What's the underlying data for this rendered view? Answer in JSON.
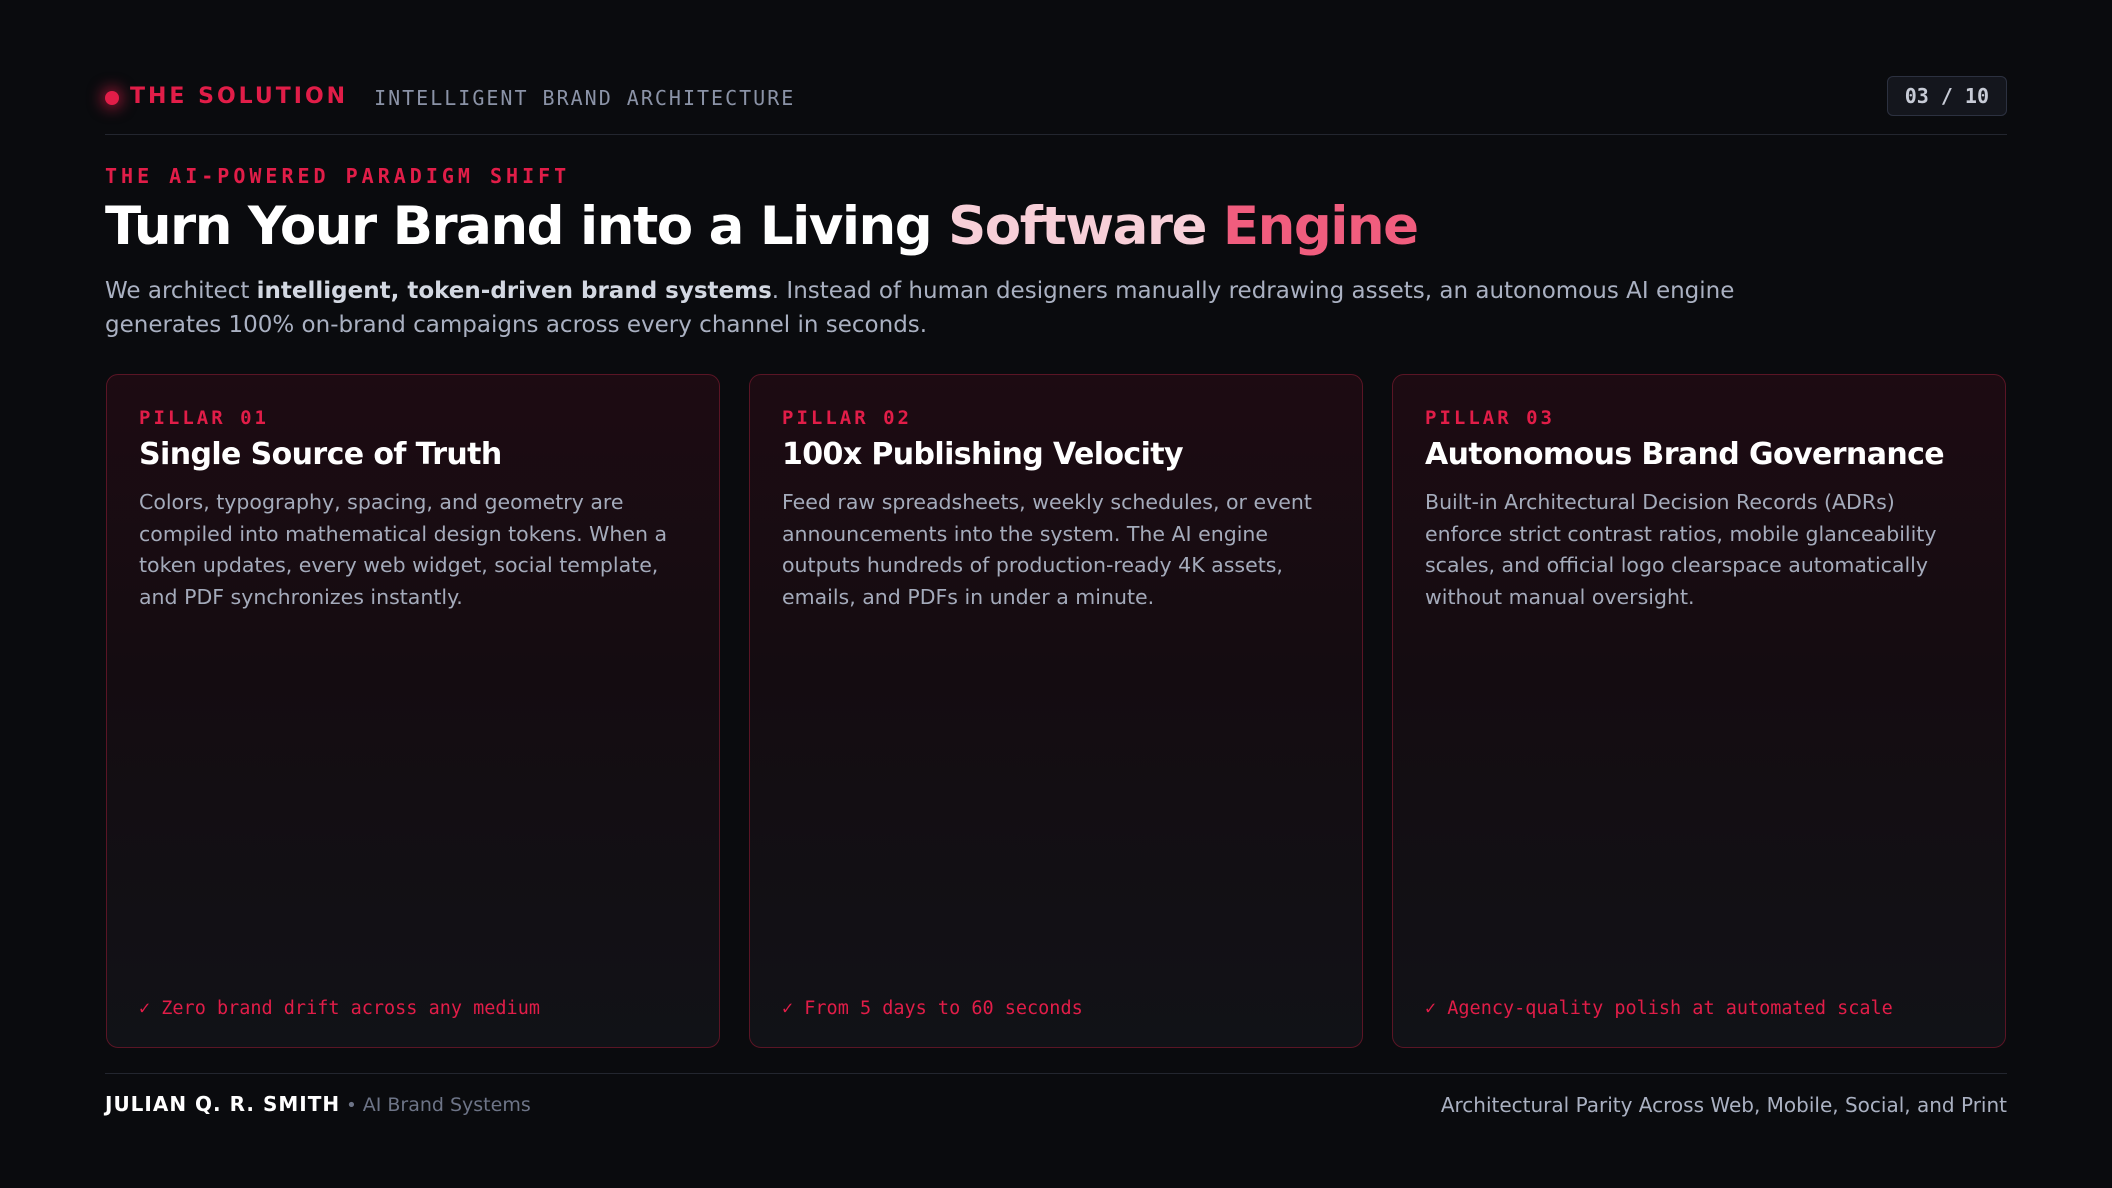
{
  "header": {
    "section_label": "THE SOLUTION",
    "section_subtitle": "INTELLIGENT BRAND ARCHITECTURE",
    "page_counter": "03 / 10"
  },
  "hero": {
    "eyebrow": "THE AI-POWERED PARADIGM SHIFT",
    "title_main": "Turn Your Brand into a Living ",
    "title_mid": "Software ",
    "title_end": "Engine",
    "lede_prefix": "We architect ",
    "lede_bold": "intelligent, token-driven brand systems",
    "lede_suffix": ". Instead of human designers manually redrawing assets, an autonomous AI engine generates 100% on-brand campaigns across every channel in seconds."
  },
  "pillars": [
    {
      "label": "PILLAR 01",
      "title": "Single Source of Truth",
      "description": "Colors, typography, spacing, and geometry are compiled into mathematical design tokens. When a token updates, every web widget, social template, and PDF synchronizes instantly.",
      "highlight": "✓ Zero brand drift across any medium"
    },
    {
      "label": "PILLAR 02",
      "title": "100x Publishing Velocity",
      "description": "Feed raw spreadsheets, weekly schedules, or event announcements into the system. The AI engine outputs hundreds of production-ready 4K assets, emails, and PDFs in under a minute.",
      "highlight": "✓ From 5 days to 60 seconds"
    },
    {
      "label": "PILLAR 03",
      "title": "Autonomous Brand Governance",
      "description": "Built-in Architectural Decision Records (ADRs) enforce strict contrast ratios, mobile glanceability scales, and official logo clearspace automatically without manual oversight.",
      "highlight": "✓ Agency-quality polish at automated scale"
    }
  ],
  "footer": {
    "author": "JULIAN Q. R. SMITH",
    "separator": "•",
    "role": "AI Brand Systems",
    "tagline": "Architectural Parity Across Web, Mobile, Social, and Print"
  },
  "colors": {
    "background": "#0a0b0e",
    "accent": "#e11d48",
    "accent_light": "#f05d7e",
    "text_muted": "#aab1c2"
  }
}
